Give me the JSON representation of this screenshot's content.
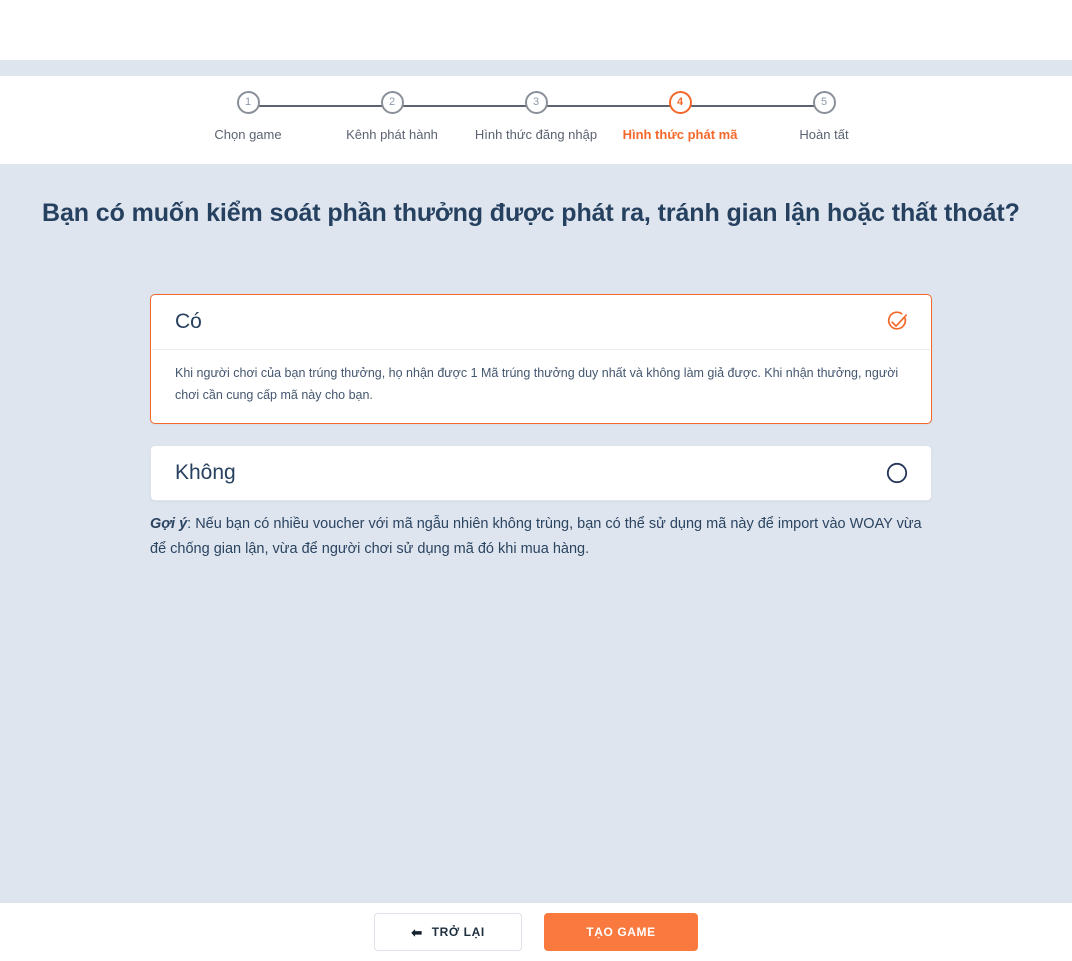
{
  "stepper": {
    "steps": [
      {
        "number": "1",
        "label": "Chọn game",
        "active": false
      },
      {
        "number": "2",
        "label": "Kênh phát hành",
        "active": false
      },
      {
        "number": "3",
        "label": "Hình thức đăng nhập",
        "active": false
      },
      {
        "number": "4",
        "label": "Hình thức phát mã",
        "active": true
      },
      {
        "number": "5",
        "label": "Hoàn tất",
        "active": false
      }
    ]
  },
  "main": {
    "heading": "Bạn có muốn kiểm soát phần thưởng được phát ra, tránh gian lận hoặc thất thoát?",
    "options": [
      {
        "title": "Có",
        "selected": true,
        "icon": "check-circle-icon",
        "description": "Khi người chơi của bạn trúng thưởng, họ nhận được 1 Mã trúng thưởng duy nhất và không làm giả được. Khi nhận thưởng, người chơi cần cung cấp mã này cho bạn."
      },
      {
        "title": "Không",
        "selected": false,
        "icon": "empty-circle-icon",
        "description": ""
      }
    ],
    "hint": {
      "label": "Gợi ý",
      "text": ": Nếu bạn có nhiều voucher với mã ngẫu nhiên không trùng, bạn có thể sử dụng mã này để import vào WOAY vừa để chống gian lận, vừa để người chơi sử dụng mã đó khi mua hàng."
    }
  },
  "footer": {
    "back_label": "TRỞ LẠI",
    "back_icon": "arrow-left-icon",
    "primary_label": "TẠO GAME"
  },
  "colors": {
    "accent": "#f4682a",
    "primary_button": "#f9793f",
    "text_dark": "#26415f",
    "background": "#eaeef4",
    "pattern": "#dee5ef",
    "inactive_step": "#8a9099"
  }
}
